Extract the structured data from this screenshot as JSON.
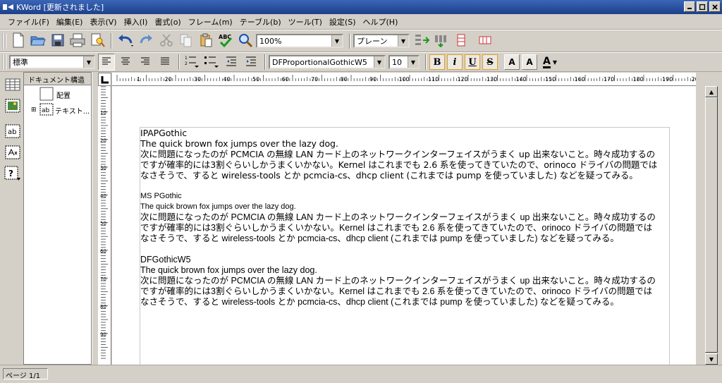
{
  "window": {
    "title": "KWord [更新されました]"
  },
  "menu": [
    "ファイル(F)",
    "編集(E)",
    "表示(V)",
    "挿入(I)",
    "書式(o)",
    "フレーム(m)",
    "テーブル(b)",
    "ツール(T)",
    "設定(S)",
    "ヘルプ(H)"
  ],
  "toolbar1": {
    "zoom": "100%",
    "view_mode": "プレーン"
  },
  "toolbar2": {
    "style": "標準",
    "font": "DFProportionalGothicW5",
    "size": "10",
    "bold": "B",
    "italic": "i",
    "underline": "U",
    "strike": "S",
    "superscript": "A",
    "subscript": "A",
    "color": "A"
  },
  "doc_panel": {
    "header": "ドキュメント構造",
    "items": [
      "配置",
      "テキスト..."
    ]
  },
  "ruler": {
    "h_labels": [
      "1",
      "20",
      "30",
      "40",
      "50",
      "60",
      "70",
      "80",
      "90",
      "100",
      "110",
      "120",
      "130",
      "140",
      "150",
      "160",
      "170",
      "180",
      "190",
      "200"
    ],
    "v_labels": [
      "10",
      "20",
      "30",
      "40",
      "50",
      "60",
      "70",
      "80",
      "90"
    ]
  },
  "document": [
    {
      "font_name": "IPAPGothic",
      "sample": "The quick brown fox jumps over the lazy dog.",
      "lines": [
        "次に問題になったのが PCMCIA の無線 LAN カード上のネットワークインターフェイスがうまく up 出来ないこと。時々成功するの",
        "ですが確率的には3割ぐらいしかうまくいかない。Kernel はこれまでも 2.6 系を使ってきていたので、orinoco ドライバの問題では",
        "なさそうで、すると wireless-tools とか pcmcia-cs、dhcp client (これまでは pump を使っていました) などを疑ってみる。"
      ]
    },
    {
      "font_name": "MS PGothic",
      "sample": "The quick brown fox jumps over the lazy dog.",
      "lines": [
        "次に問題になったのが PCMCIA の無線 LAN カード上のネットワークインターフェイスがうまく up 出来ないこと。時々成功するの",
        "ですが確率的には3割ぐらいしかうまくいかない。Kernel はこれまでも 2.6 系を使ってきていたので、orinoco ドライバの問題では",
        "なさそうで、すると wireless-tools とか pcmcia-cs、dhcp client (これまでは pump を使っていました) などを疑ってみる。"
      ]
    },
    {
      "font_name": "DFGothicW5",
      "sample": "The quick brown fox jumps over the lazy dog.",
      "lines": [
        "次に問題になったのが PCMCIA の無線 LAN カード上のネットワークインターフェイスがうまく up 出来ないこと。時々成功するの",
        "ですが確率的には3割ぐらいしかうまくいかない。Kernel はこれまでも 2.6 系を使ってきていたので、orinoco ドライバの問題では",
        "なさそうで、すると wireless-tools とか pcmcia-cs、dhcp client (これまでは pump を使っていました) などを疑ってみる。"
      ]
    }
  ],
  "status": {
    "page": "ページ 1/1"
  }
}
